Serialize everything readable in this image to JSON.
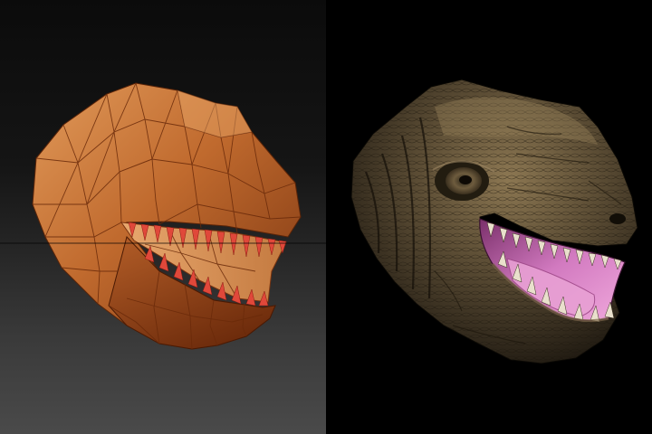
{
  "scene": {
    "background_left": "#1a1a1a",
    "background_right": "#000000",
    "colors": {
      "lowpoly_base": "#b8602a",
      "lowpoly_light": "#d98b4d",
      "lowpoly_dark": "#7a3512",
      "teeth_red": "#e0483a",
      "sculpt_skin": "#4a3f2c",
      "sculpt_highlight": "#9a8460",
      "mouth_pink": "#c86fb4"
    },
    "panels": [
      {
        "subject": "low-poly-trex-head"
      },
      {
        "subject": "sculpted-trex-head"
      }
    ]
  }
}
